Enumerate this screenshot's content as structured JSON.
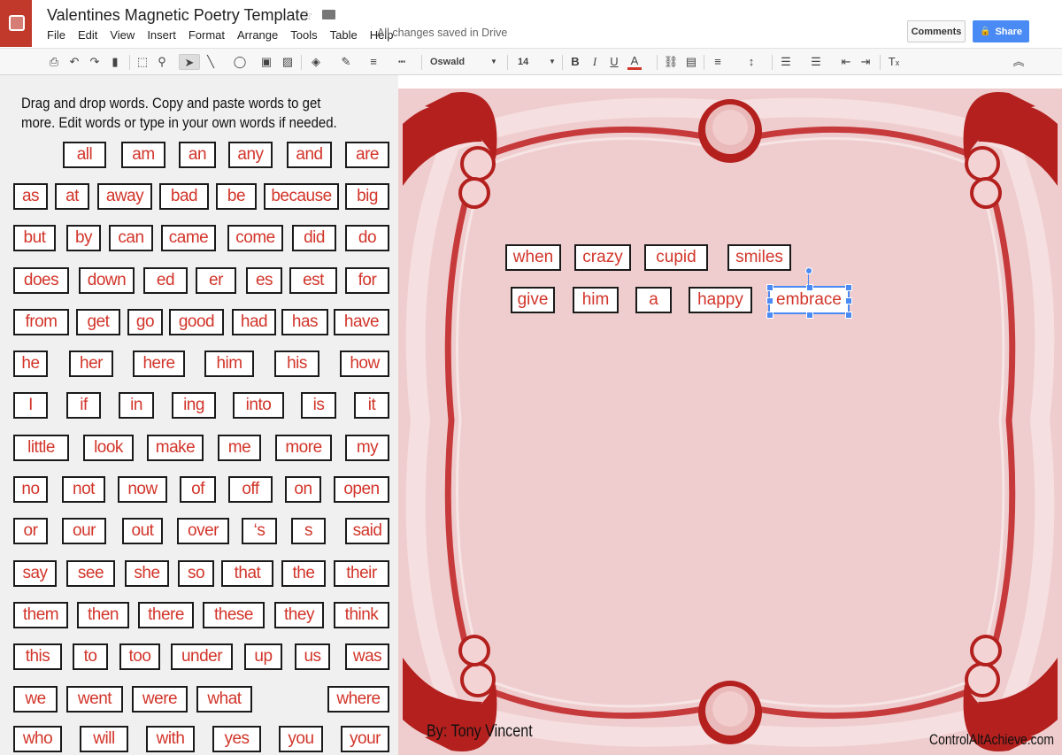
{
  "app": {
    "title": "Valentines Magnetic Poetry Template",
    "menu": [
      "File",
      "Edit",
      "View",
      "Insert",
      "Format",
      "Arrange",
      "Tools",
      "Table",
      "Help"
    ],
    "save_status": "All changes saved in Drive",
    "comments_label": "Comments",
    "share_label": "Share"
  },
  "toolbar": {
    "font_name": "Oswald",
    "font_size": "14",
    "bold": "B",
    "italic": "I",
    "underline": "U",
    "text_color_letter": "A",
    "text_color": "#d2352a",
    "clear_format": "T"
  },
  "instructions": "Drag and drop words. Copy and paste words to get more. Edit words or type in your own words if needed.",
  "word_bank": [
    "all",
    "am",
    "an",
    "any",
    "and",
    "are",
    "as",
    "at",
    "away",
    "bad",
    "be",
    "because",
    "big",
    "but",
    "by",
    "can",
    "came",
    "come",
    "did",
    "do",
    "does",
    "down",
    "ed",
    "er",
    "es",
    "est",
    "for",
    "from",
    "get",
    "go",
    "good",
    "had",
    "has",
    "have",
    "he",
    "her",
    "here",
    "him",
    "his",
    "how",
    "I",
    "if",
    "in",
    "ing",
    "into",
    "is",
    "it",
    "little",
    "look",
    "make",
    "me",
    "more",
    "my",
    "no",
    "not",
    "now",
    "of",
    "off",
    "on",
    "open",
    "or",
    "our",
    "out",
    "over",
    "‘s",
    "s",
    "said",
    "say",
    "see",
    "she",
    "so",
    "that",
    "the",
    "their",
    "them",
    "then",
    "there",
    "these",
    "they",
    "think",
    "this",
    "to",
    "too",
    "under",
    "up",
    "us",
    "was",
    "we",
    "went",
    "were",
    "what",
    "where",
    "who",
    "will",
    "with",
    "yes",
    "you",
    "your"
  ],
  "poem": [
    "when",
    "crazy",
    "cupid",
    "smiles",
    "give",
    "him",
    "a",
    "happy",
    "embrace"
  ],
  "byline": "By: Tony Vincent",
  "credit": "ControlAltAchieve.com",
  "colors": {
    "accent": "#d2352a",
    "frame_dark": "#b3201e",
    "slide_bg": "#efcdce",
    "share": "#4a8af4"
  }
}
